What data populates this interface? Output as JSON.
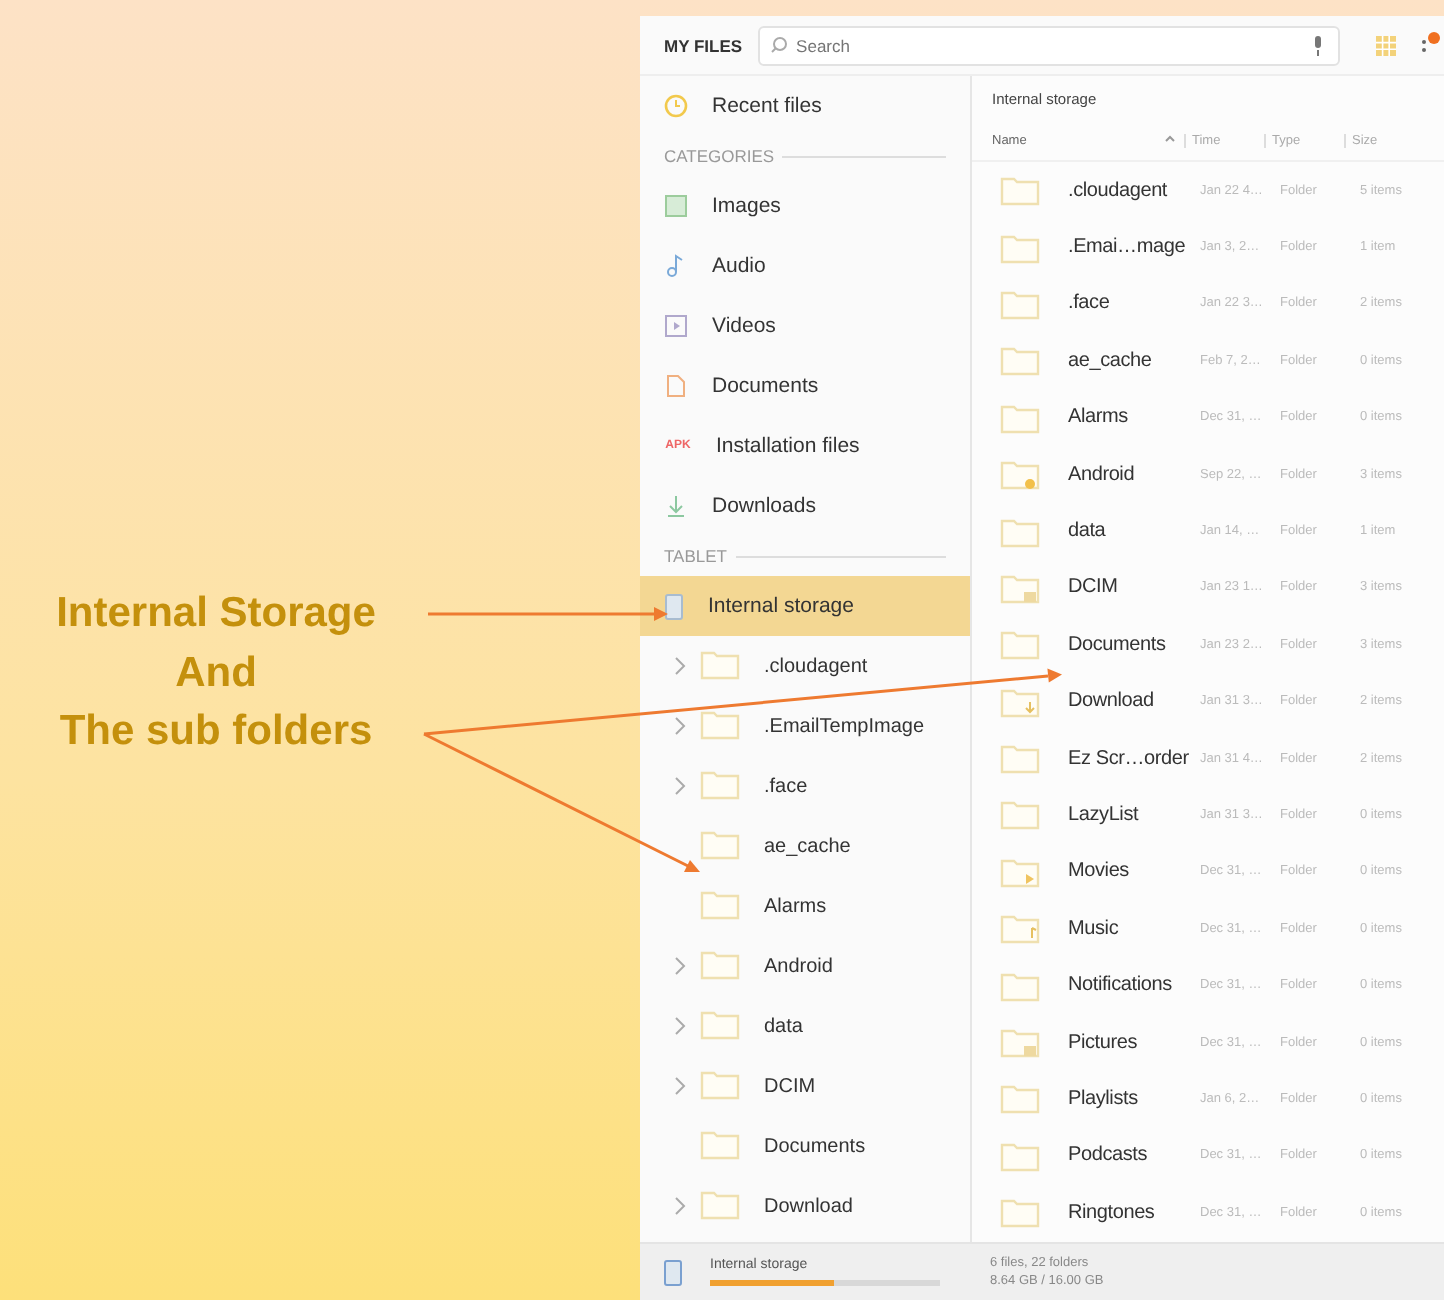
{
  "annotation": {
    "lines": [
      "Internal Storage",
      "And",
      "The sub folders"
    ]
  },
  "header": {
    "title": "MY FILES",
    "search": {
      "placeholder": "Search"
    }
  },
  "sidebar": {
    "recent": {
      "label": "Recent files",
      "kind": "recent",
      "selected": false
    },
    "sections": [
      {
        "title": "CATEGORIES",
        "items": [
          {
            "label": "Images",
            "kind": "images",
            "selected": false
          },
          {
            "label": "Audio",
            "kind": "audio",
            "selected": false
          },
          {
            "label": "Videos",
            "kind": "videos",
            "selected": false
          },
          {
            "label": "Documents",
            "kind": "documents",
            "selected": false
          },
          {
            "label": "Installation files",
            "kind": "apk",
            "icon_text": "APK",
            "selected": false
          },
          {
            "label": "Downloads",
            "kind": "downloads",
            "selected": false
          }
        ]
      },
      {
        "title": "TABLET",
        "items": [
          {
            "label": "Internal storage",
            "kind": "storage",
            "selected": true,
            "children": [
              {
                "label": ".cloudagent",
                "expandable": true,
                "selected": false
              },
              {
                "label": ".EmailTempImage",
                "expandable": true,
                "selected": false
              },
              {
                "label": ".face",
                "expandable": true,
                "selected": false
              },
              {
                "label": "ae_cache",
                "expandable": false,
                "selected": false
              },
              {
                "label": "Alarms",
                "expandable": false,
                "selected": false
              },
              {
                "label": "Android",
                "expandable": true,
                "selected": false
              },
              {
                "label": "data",
                "expandable": true,
                "selected": false
              },
              {
                "label": "DCIM",
                "expandable": true,
                "selected": false
              },
              {
                "label": "Documents",
                "expandable": false,
                "selected": false
              },
              {
                "label": "Download",
                "expandable": true,
                "selected": false
              }
            ]
          }
        ]
      }
    ]
  },
  "files": {
    "path": "Internal storage",
    "columns": [
      "Name",
      "Time",
      "Type",
      "Size"
    ],
    "rows": [
      {
        "name": ".cloudagent",
        "time": "Jan 22 4…",
        "type": "Folder",
        "size": "5 items",
        "kind": "plain"
      },
      {
        "name": ".Emai…mage",
        "time": "Jan 3, 2…",
        "type": "Folder",
        "size": "1 item",
        "kind": "plain"
      },
      {
        "name": ".face",
        "time": "Jan 22 3…",
        "type": "Folder",
        "size": "2 items",
        "kind": "plain"
      },
      {
        "name": "ae_cache",
        "time": "Feb 7, 2…",
        "type": "Folder",
        "size": "0 items",
        "kind": "plain"
      },
      {
        "name": "Alarms",
        "time": "Dec 31, …",
        "type": "Folder",
        "size": "0 items",
        "kind": "plain"
      },
      {
        "name": "Android",
        "time": "Sep 22, …",
        "type": "Folder",
        "size": "3 items",
        "kind": "system"
      },
      {
        "name": "data",
        "time": "Jan 14, …",
        "type": "Folder",
        "size": "1 item",
        "kind": "plain"
      },
      {
        "name": "DCIM",
        "time": "Jan 23 1…",
        "type": "Folder",
        "size": "3 items",
        "kind": "picture"
      },
      {
        "name": "Documents",
        "time": "Jan 23 2…",
        "type": "Folder",
        "size": "3 items",
        "kind": "plain"
      },
      {
        "name": "Download",
        "time": "Jan 31 3…",
        "type": "Folder",
        "size": "2 items",
        "kind": "download"
      },
      {
        "name": "Ez Scr…order",
        "time": "Jan 31 4…",
        "type": "Folder",
        "size": "2 items",
        "kind": "plain"
      },
      {
        "name": "LazyList",
        "time": "Jan 31 3…",
        "type": "Folder",
        "size": "0 items",
        "kind": "plain"
      },
      {
        "name": "Movies",
        "time": "Dec 31, …",
        "type": "Folder",
        "size": "0 items",
        "kind": "movie"
      },
      {
        "name": "Music",
        "time": "Dec 31, …",
        "type": "Folder",
        "size": "0 items",
        "kind": "music"
      },
      {
        "name": "Notifications",
        "time": "Dec 31, …",
        "type": "Folder",
        "size": "0 items",
        "kind": "plain"
      },
      {
        "name": "Pictures",
        "time": "Dec 31, …",
        "type": "Folder",
        "size": "0 items",
        "kind": "picture"
      },
      {
        "name": "Playlists",
        "time": "Jan 6, 2…",
        "type": "Folder",
        "size": "0 items",
        "kind": "plain"
      },
      {
        "name": "Podcasts",
        "time": "Dec 31, …",
        "type": "Folder",
        "size": "0 items",
        "kind": "plain"
      },
      {
        "name": "Ringtones",
        "time": "Dec 31, …",
        "type": "Folder",
        "size": "0 items",
        "kind": "plain"
      }
    ]
  },
  "footer": {
    "storage_label": "Internal storage",
    "level": 0.54,
    "counts": "6 files, 22 folders",
    "usage": "8.64 GB / 16.00 GB"
  }
}
